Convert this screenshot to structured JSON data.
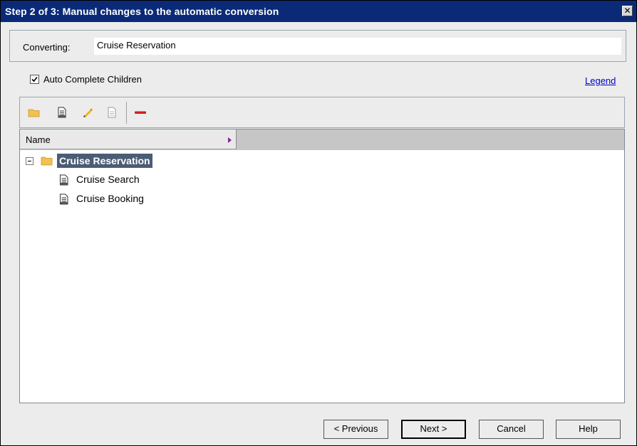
{
  "window": {
    "title": "Step 2 of 3: Manual changes to the automatic conversion",
    "close_glyph": "✕"
  },
  "converting": {
    "label": "Converting:",
    "value": "Cruise Reservation"
  },
  "options": {
    "auto_complete_label": "Auto Complete Children",
    "auto_complete_checked": true,
    "legend_link": "Legend"
  },
  "toolbar": {
    "icons": [
      "new-folder-icon",
      "new-requirement-icon",
      "edit-icon",
      "document-icon",
      "delete-icon"
    ]
  },
  "tree": {
    "column_header": "Name",
    "root": {
      "label": "Cruise Reservation",
      "expanded": true,
      "selected": true,
      "icon": "folder-icon"
    },
    "children": [
      {
        "label": "Cruise Search",
        "icon": "requirement-icon"
      },
      {
        "label": "Cruise Booking",
        "icon": "requirement-icon"
      }
    ]
  },
  "buttons": {
    "previous": "< Previous",
    "next": "Next >",
    "cancel": "Cancel",
    "help": "Help"
  },
  "colors": {
    "titlebar": "#0a2a78",
    "selection": "#4b5d75",
    "link": "#0000cc",
    "folder": "#f2c14e"
  }
}
